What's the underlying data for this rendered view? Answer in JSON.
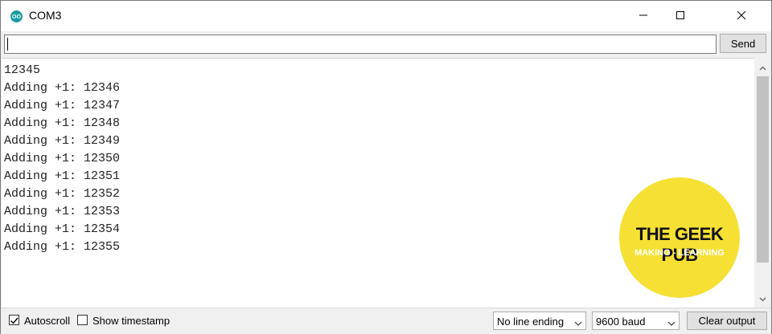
{
  "window": {
    "title": "COM3",
    "app_icon": "arduino-icon",
    "controls": [
      "minimize-icon",
      "maximize-icon",
      "close-icon"
    ]
  },
  "input": {
    "value": "",
    "send_label": "Send"
  },
  "output": {
    "lines": [
      "12345",
      "Adding +1: 12346",
      "Adding +1: 12347",
      "Adding +1: 12348",
      "Adding +1: 12349",
      "Adding +1: 12350",
      "Adding +1: 12351",
      "Adding +1: 12352",
      "Adding +1: 12353",
      "Adding +1: 12354",
      "Adding +1: 12355"
    ]
  },
  "logo": {
    "title": "THE GEEK PUB",
    "subtitle": "MAKING - LEARNING",
    "color": "#f6e034"
  },
  "footer": {
    "autoscroll_label": "Autoscroll",
    "autoscroll_checked": true,
    "timestamp_label": "Show timestamp",
    "timestamp_checked": false,
    "line_ending": "No line ending",
    "baud": "9600 baud",
    "clear_label": "Clear output"
  },
  "colors": {
    "accent": "#1a9ba1",
    "scroll_thumb": "#c1c1c1"
  }
}
